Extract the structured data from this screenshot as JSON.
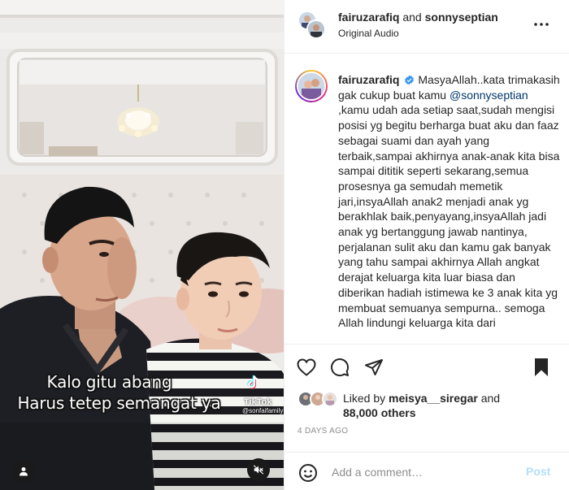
{
  "colors": {
    "accent_blue": "#0095f6",
    "post_disabled": "#b2dffc",
    "mention": "#00376b",
    "muted_text": "#8e8e8e",
    "verified": "#3897f0"
  },
  "media": {
    "caption_line1": "Kalo gitu abang",
    "caption_line2": "Harus tetep semangat ya",
    "watermark_name": "TikTok",
    "watermark_handle": "@sonfaifamily",
    "icons": {
      "user_tag": "user-icon",
      "mute": "speaker-muted-icon"
    }
  },
  "header": {
    "user1": "fairuzarafiq",
    "conjunction": "and",
    "user2": "sonnyseptian",
    "audio": "Original Audio",
    "more_icon": "more-horizontal-icon"
  },
  "caption": {
    "username": "fairuzarafiq",
    "verified": true,
    "text_before": "MasyaAllah..kata trimakasih gak cukup buat kamu ",
    "mention": "@sonnyseptian",
    "text_after": " ,kamu udah ada setiap saat,sudah mengisi posisi yg begitu berharga buat aku dan faaz sebagai suami dan ayah yang terbaik,sampai akhirnya anak-anak kita bisa sampai dititik seperti sekarang,semua prosesnya ga semudah memetik jari,insyaAllah anak2 menjadi anak yg berakhlak baik,penyayang,insyaAllah jadi anak yg bertanggung jawab nantinya, perjalanan sulit aku dan kamu gak banyak yang tahu sampai akhirnya Allah angkat derajat keluarga kita luar biasa dan diberikan hadiah istimewa ke 3 anak kita yg membuat semuanya sempurna.. semoga Allah lindungi keluarga kita dari"
  },
  "actions": {
    "like_icon": "heart-icon",
    "comment_icon": "comment-bubble-icon",
    "share_icon": "paper-plane-icon",
    "save_icon": "bookmark-icon"
  },
  "likes": {
    "prefix": "Liked by ",
    "liker": "meisya__siregar",
    "suffix": " and",
    "others": "88,000 others"
  },
  "timestamp": "4 DAYS AGO",
  "comment_box": {
    "emoji_icon": "smiley-icon",
    "placeholder": "Add a comment…",
    "post_label": "Post"
  }
}
